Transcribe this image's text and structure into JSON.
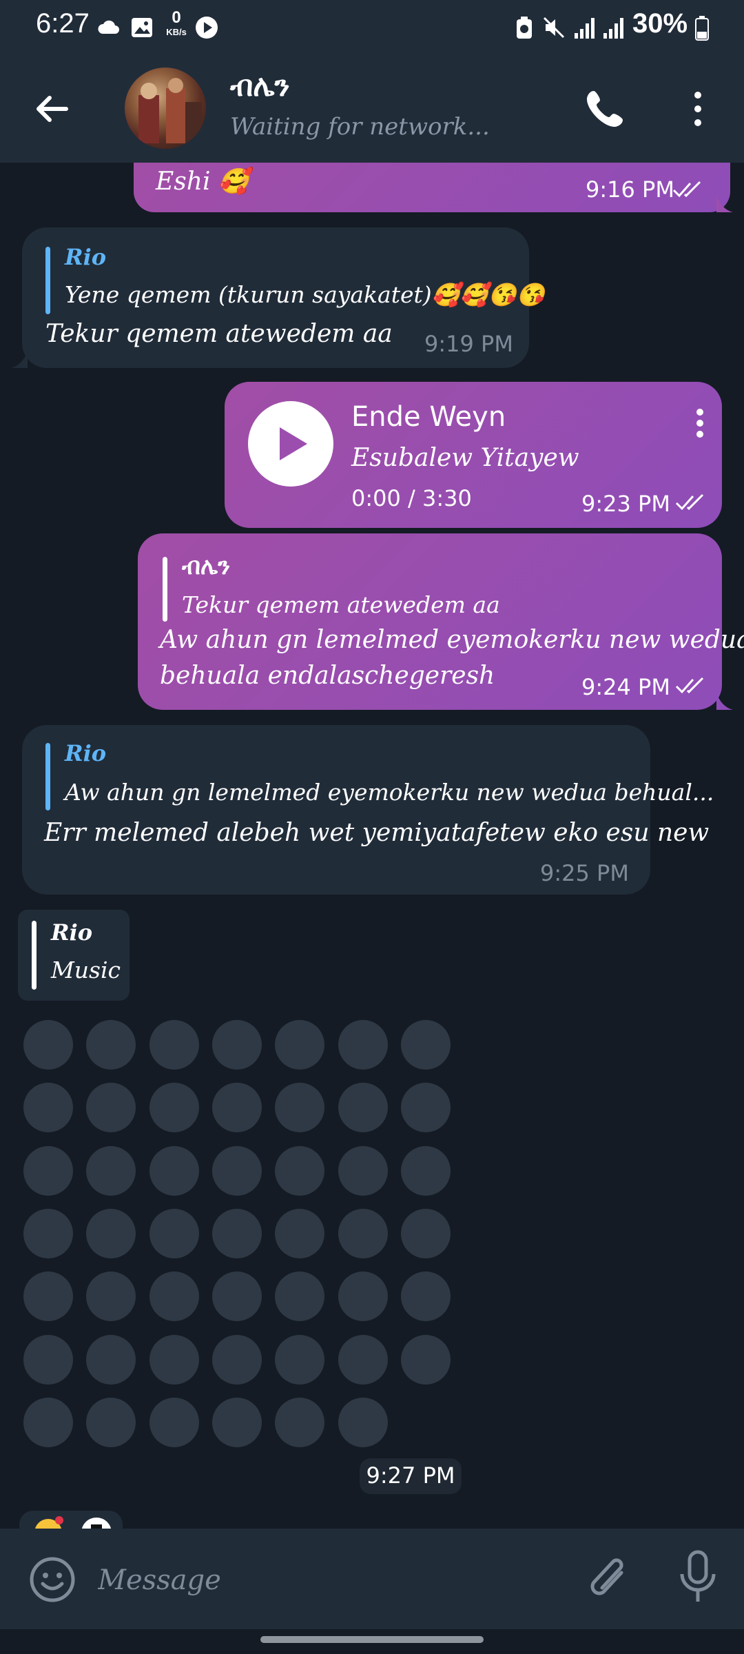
{
  "status_bar": {
    "time": "6:27",
    "net_speed_value": "0",
    "net_speed_unit": "KB/s",
    "battery": "30%"
  },
  "header": {
    "title": "ብሌን",
    "status": "Waiting for network..."
  },
  "messages": [
    {
      "id": "m1",
      "direction": "out",
      "text": "Eshi 🥰",
      "time": "9:16 PM",
      "read": true
    },
    {
      "id": "m2",
      "direction": "in",
      "reply_to": {
        "name": "Rio",
        "text": "Yene qemem (tkurun sayakatet)🥰🥰😘😘"
      },
      "text": "Tekur qemem atewedem aa",
      "time": "9:19 PM"
    },
    {
      "id": "m3",
      "direction": "out",
      "type": "audio",
      "title": "Ende Weyn",
      "performer": "Esubalew Yitayew",
      "progress": "0:00 / 3:30",
      "time": "9:23 PM",
      "read": true
    },
    {
      "id": "m4",
      "direction": "out",
      "reply_to": {
        "name": "ብሌን",
        "text": "Tekur qemem atewedem aa"
      },
      "text_line1": "Aw ahun gn lemelmed eyemokerku new wedua",
      "text_line2": "behuala endalaschegeresh",
      "time": "9:24 PM",
      "read": true
    },
    {
      "id": "m5",
      "direction": "in",
      "reply_to": {
        "name": "Rio",
        "text": "Aw ahun gn lemelmed eyemokerku new wedua behual..."
      },
      "text": "Err melemed alebeh wet yemiyatafetew eko esu new",
      "time": "9:25 PM"
    },
    {
      "id": "m6",
      "direction": "in",
      "type": "sticker_reply",
      "reply_to": {
        "name": "Rio",
        "text": "Music"
      }
    }
  ],
  "date_chip": "9:27 PM",
  "input": {
    "placeholder": "Message"
  },
  "colors": {
    "background": "#141b24",
    "header": "#212c39",
    "bubble_out": "#9c4eaf",
    "bubble_in": "#212c39",
    "reply_accent": "#5eb5f7",
    "muted_text": "#7f8b98"
  },
  "icons": [
    "back-arrow-icon",
    "phone-icon",
    "more-vert-icon",
    "play-icon",
    "double-check-icon",
    "emoji-icon",
    "attach-icon",
    "mic-icon"
  ]
}
